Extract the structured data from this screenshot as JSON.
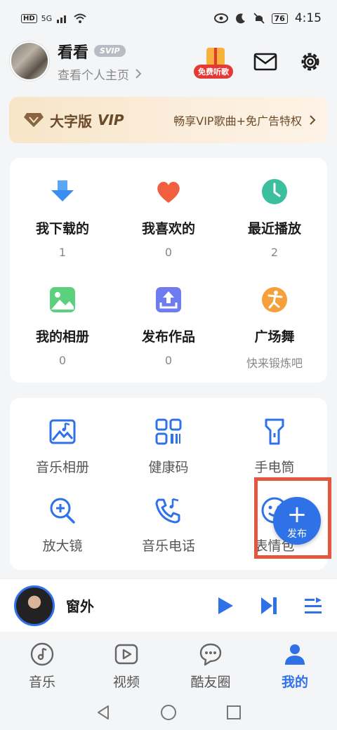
{
  "status_bar": {
    "network": "HD",
    "signal_label": "5G",
    "battery": "76",
    "time": "4:15"
  },
  "profile": {
    "name": "看看",
    "badge": "SVIP",
    "link": "查看个人主页",
    "gift_label": "免费听歌"
  },
  "vip_banner": {
    "title_prefix": "大字版",
    "title_vip": "VIP",
    "description": "畅享VIP歌曲+免广告特权"
  },
  "stats": [
    {
      "label": "我下载的",
      "value": "1",
      "icon": "download-icon",
      "color": "#3b8ef0"
    },
    {
      "label": "我喜欢的",
      "value": "0",
      "icon": "heart-icon",
      "color": "#f0603e"
    },
    {
      "label": "最近播放",
      "value": "2",
      "icon": "clock-icon",
      "color": "#3cbf9e"
    },
    {
      "label": "我的相册",
      "value": "0",
      "icon": "image-icon",
      "color": "#5bd07d"
    },
    {
      "label": "发布作品",
      "value": "0",
      "icon": "upload-icon",
      "color": "#6d7cf0"
    },
    {
      "label": "广场舞",
      "value": "快来锻炼吧",
      "icon": "dance-icon",
      "color": "#f5a03a"
    }
  ],
  "tools": [
    {
      "label": "音乐相册",
      "icon": "photo-album-icon"
    },
    {
      "label": "健康码",
      "icon": "qr-code-icon"
    },
    {
      "label": "手电筒",
      "icon": "flashlight-icon"
    },
    {
      "label": "放大镜",
      "icon": "magnifier-icon"
    },
    {
      "label": "音乐电话",
      "icon": "music-phone-icon"
    },
    {
      "label": "表情包",
      "icon": "emoji-icon"
    }
  ],
  "fab": {
    "label": "发布"
  },
  "player": {
    "song": "窗外"
  },
  "tabs": [
    {
      "label": "音乐",
      "icon": "music-note-icon"
    },
    {
      "label": "视频",
      "icon": "video-icon"
    },
    {
      "label": "酷友圈",
      "icon": "chat-bubble-icon"
    },
    {
      "label": "我的",
      "icon": "person-icon"
    }
  ],
  "colors": {
    "accent": "#2f72e8",
    "fab_highlight": "#e4573e"
  }
}
